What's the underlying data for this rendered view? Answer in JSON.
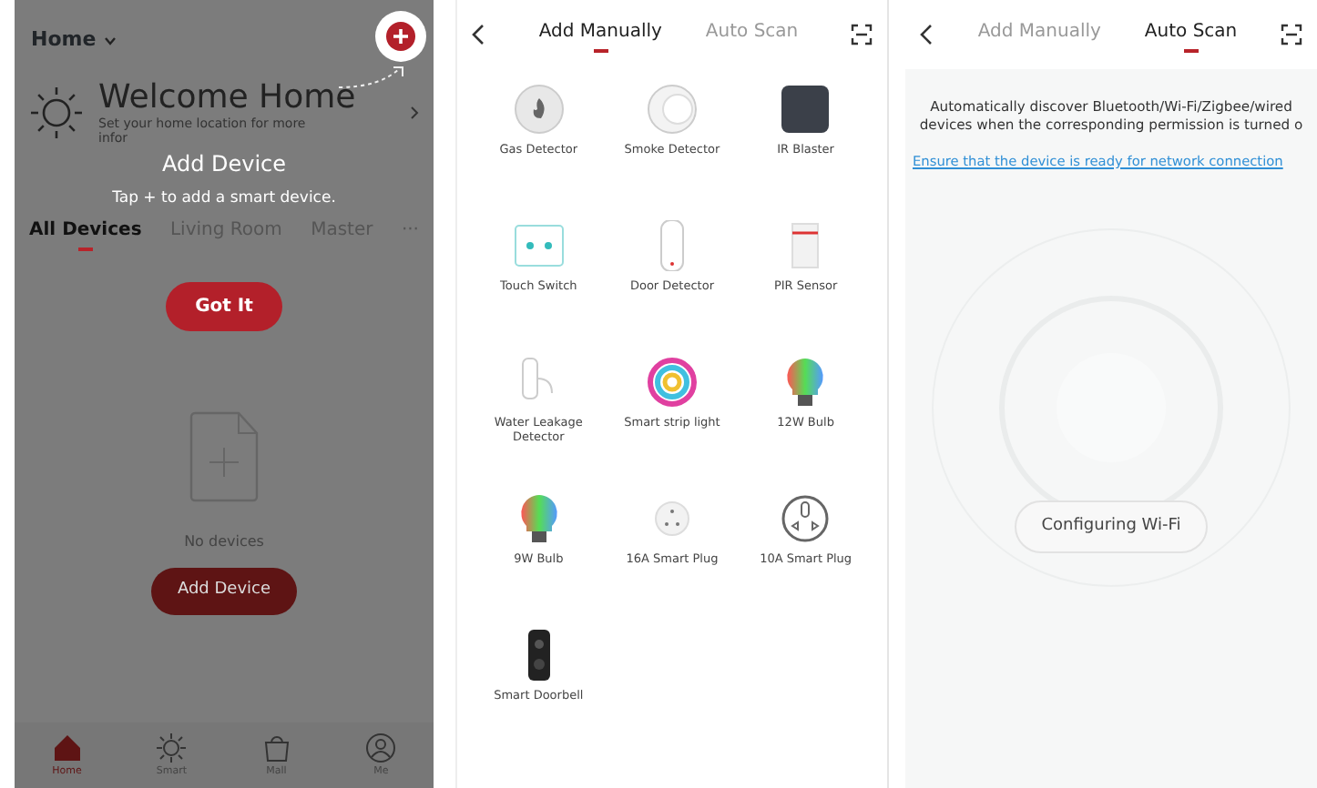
{
  "home_screen": {
    "home_selector": "Home",
    "welcome": {
      "title": "Welcome Home",
      "subtitle": "Set your home location for more infor"
    },
    "guide": {
      "title": "Add Device",
      "hint": "Tap + to add a smart device.",
      "button": "Got It"
    },
    "tabs": [
      {
        "label": "All Devices",
        "selected": true
      },
      {
        "label": "Living Room",
        "selected": false
      },
      {
        "label": "Master",
        "selected": false
      },
      {
        "label": "···",
        "selected": false
      }
    ],
    "empty_state": {
      "message": "No devices",
      "button": "Add Device"
    },
    "bottom_nav": [
      {
        "label": "Home",
        "kind": "home",
        "selected": true
      },
      {
        "label": "Smart",
        "kind": "smart",
        "selected": false
      },
      {
        "label": "Mall",
        "kind": "mall",
        "selected": false
      },
      {
        "label": "Me",
        "kind": "me",
        "selected": false
      }
    ]
  },
  "manual_screen": {
    "tabs": [
      {
        "label": "Add Manually",
        "selected": true
      },
      {
        "label": "Auto Scan",
        "selected": false
      }
    ],
    "devices": [
      {
        "name": "Gas Detector",
        "kind": "gas"
      },
      {
        "name": "Smoke Detector",
        "kind": "smoke"
      },
      {
        "name": "IR Blaster",
        "kind": "ir"
      },
      {
        "name": "Touch Switch",
        "kind": "switch"
      },
      {
        "name": "Door Detector",
        "kind": "door"
      },
      {
        "name": "PIR Sensor",
        "kind": "pir"
      },
      {
        "name": "Water Leakage Detector",
        "kind": "water"
      },
      {
        "name": "Smart strip light",
        "kind": "strip"
      },
      {
        "name": "12W Bulb",
        "kind": "bulb"
      },
      {
        "name": "9W Bulb",
        "kind": "bulb"
      },
      {
        "name": "16A Smart Plug",
        "kind": "plug"
      },
      {
        "name": "10A Smart Plug",
        "kind": "plug10"
      },
      {
        "name": "Smart Doorbell",
        "kind": "doorbell"
      }
    ]
  },
  "scan_screen": {
    "tabs": [
      {
        "label": "Add Manually",
        "selected": false
      },
      {
        "label": "Auto Scan",
        "selected": true
      }
    ],
    "description": "Automatically discover Bluetooth/Wi-Fi/Zigbee/wired devices when the corresponding permission is turned o",
    "link": "Ensure that the device is ready for network connection",
    "button": "Configuring Wi-Fi"
  }
}
